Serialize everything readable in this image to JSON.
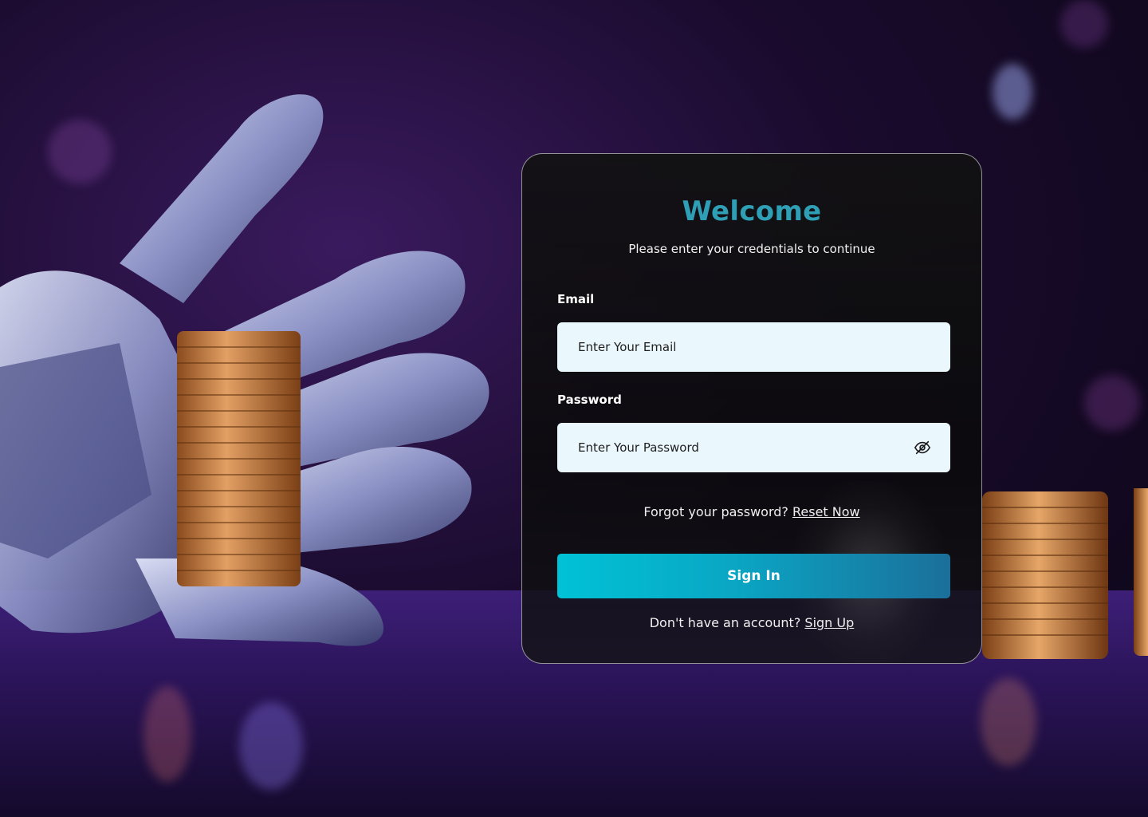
{
  "card": {
    "title": "Welcome",
    "subtitle": "Please enter your credentials to continue"
  },
  "email": {
    "label": "Email",
    "placeholder": "Enter Your Email",
    "value": ""
  },
  "password": {
    "label": "Password",
    "placeholder": "Enter Your Password",
    "value": "",
    "toggle_icon": "eye-off-icon"
  },
  "forgot": {
    "text": "Forgot your password?",
    "link": "Reset Now"
  },
  "signin_label": "Sign In",
  "signup": {
    "text": "Don't have an account?",
    "link": "Sign Up"
  },
  "colors": {
    "accent_title": "#2f9fb6",
    "button_start": "#00c2d6",
    "button_end": "#1b6f9a",
    "field_bg": "#eaf7fc"
  }
}
